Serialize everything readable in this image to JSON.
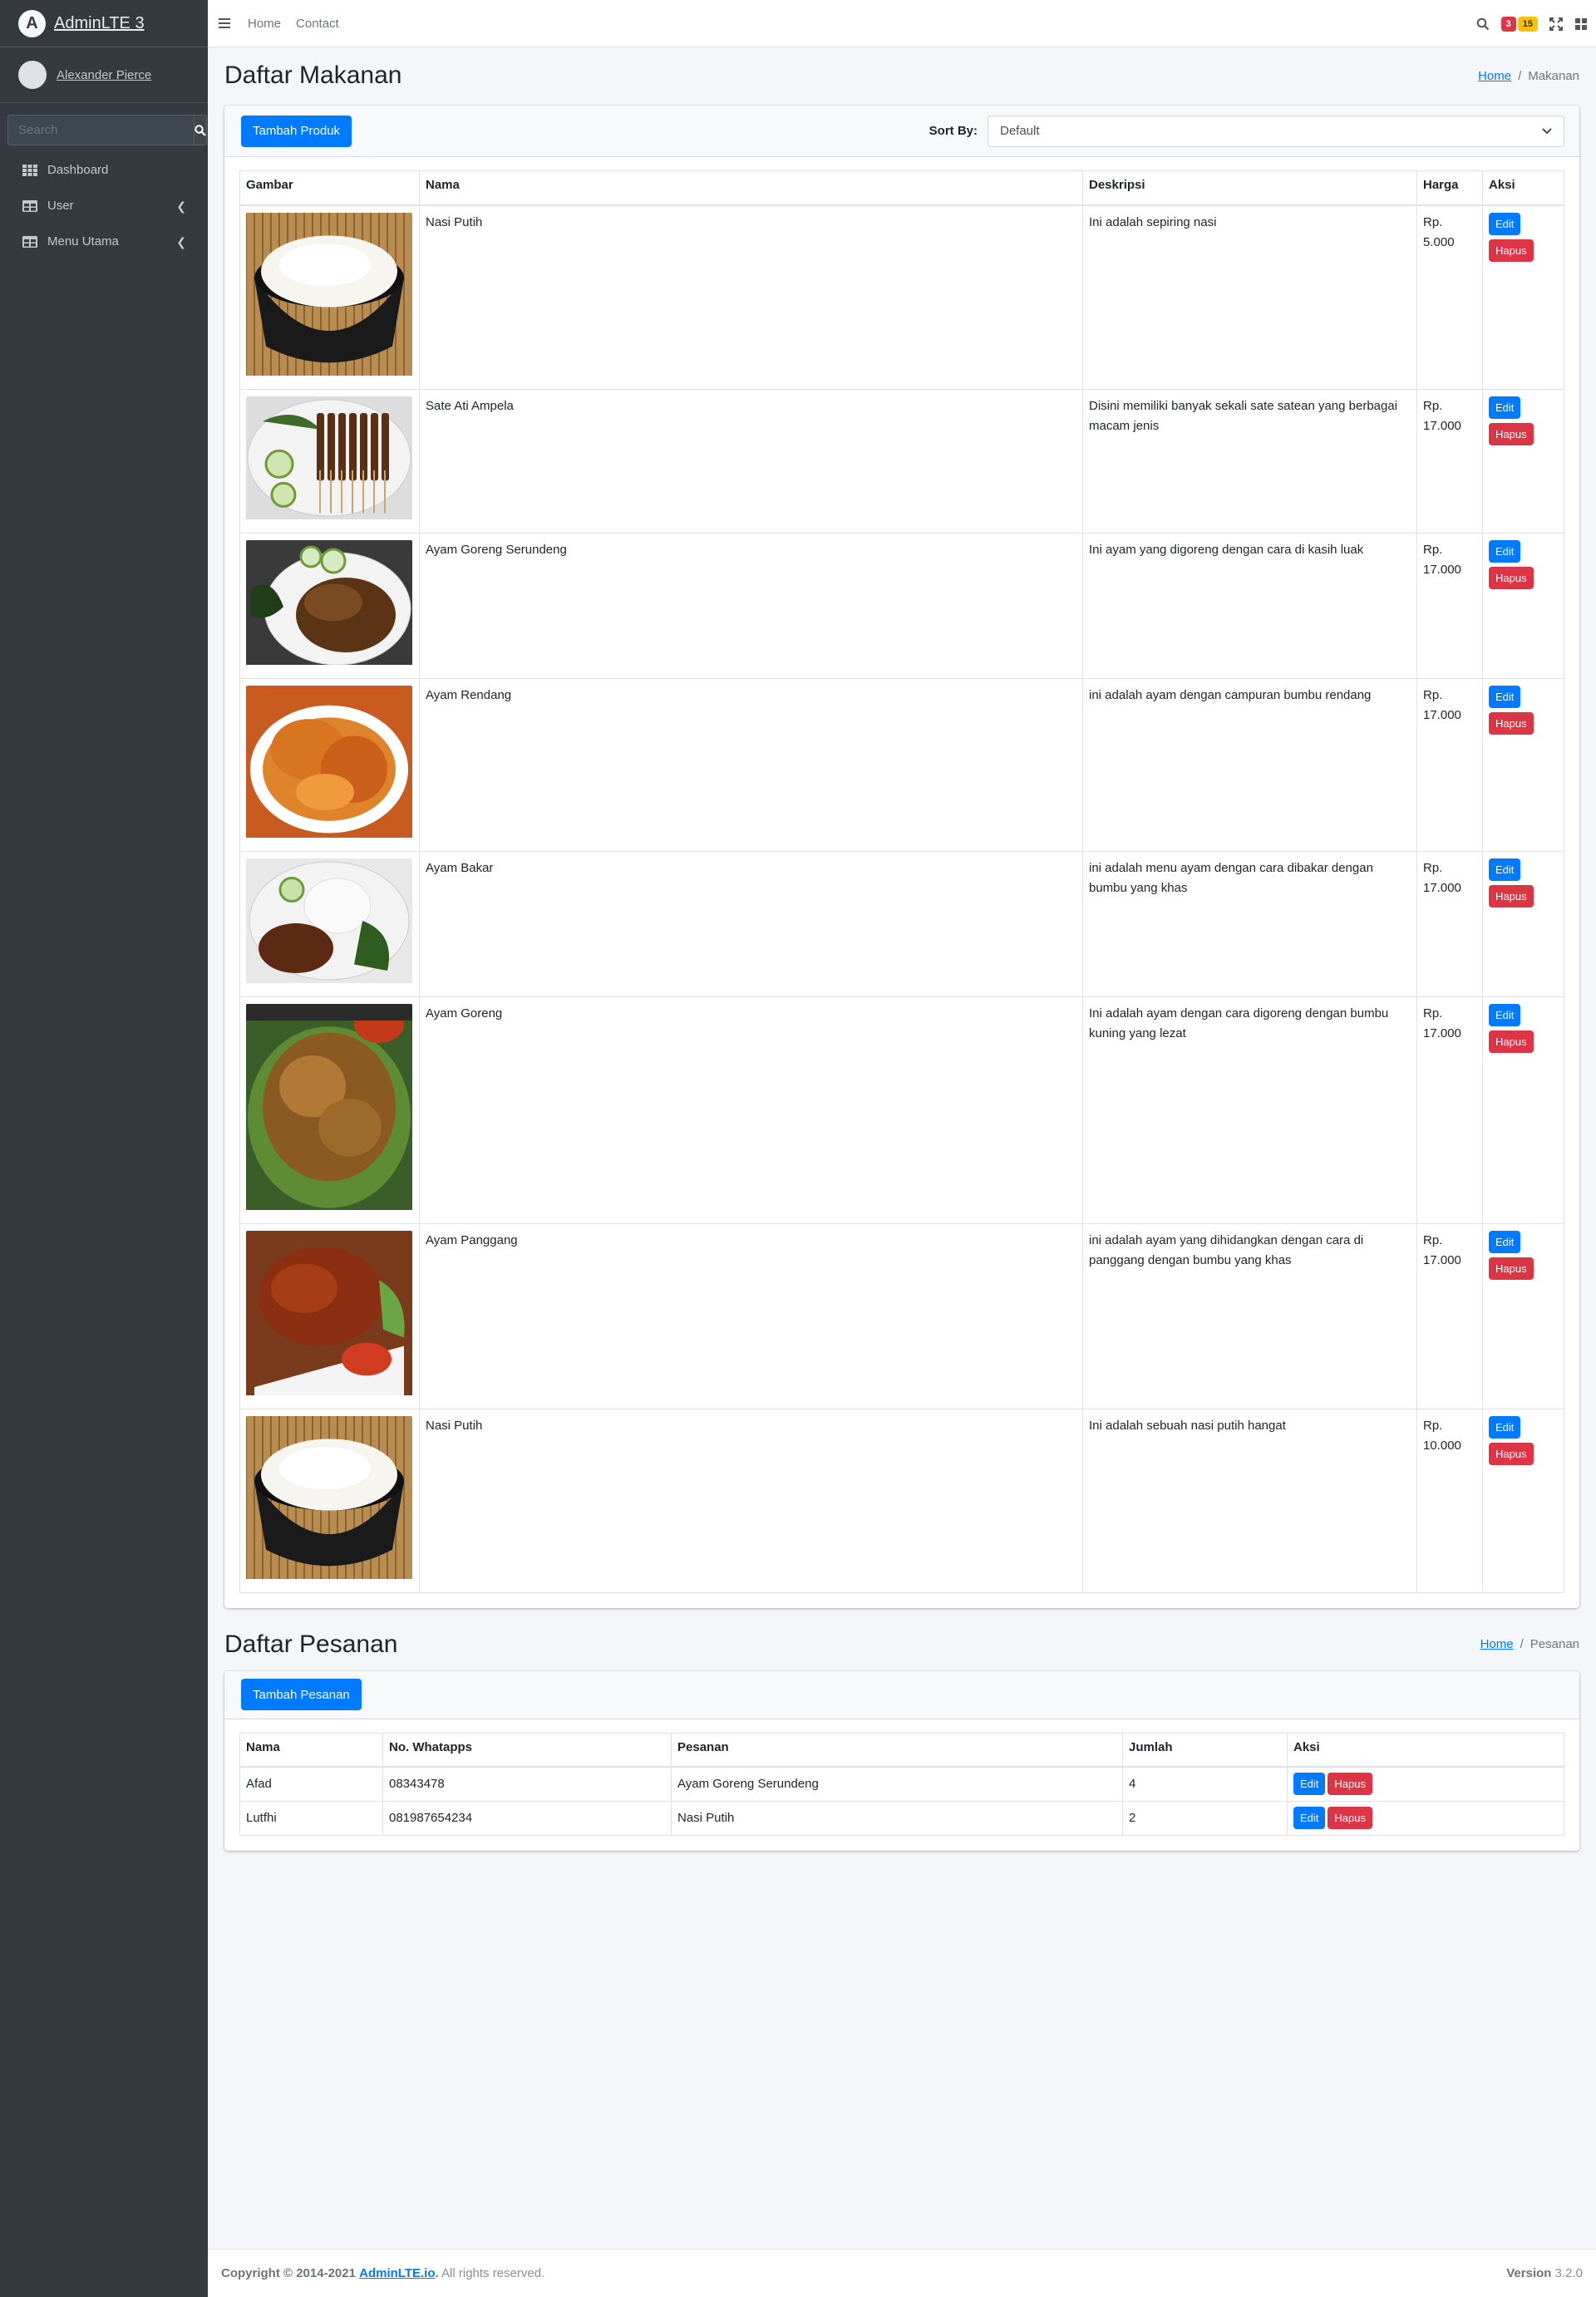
{
  "brand": {
    "name": "AdminLTE 3",
    "logo_letter": "A"
  },
  "user": {
    "name": "Alexander Pierce"
  },
  "sidebar": {
    "search_placeholder": "Search",
    "items": [
      {
        "label": "Dashboard",
        "icon": "th-icon"
      },
      {
        "label": "User",
        "icon": "table-icon"
      },
      {
        "label": "Menu Utama",
        "icon": "table-icon"
      }
    ]
  },
  "topnav": {
    "links": [
      "Home",
      "Contact"
    ],
    "messages_count": "3",
    "notifications_count": "15"
  },
  "makanan": {
    "title": "Daftar Makanan",
    "breadcrumb": {
      "home": "Home",
      "current": "Makanan"
    },
    "add_button": "Tambah Produk",
    "sort_label": "Sort By:",
    "sort_value": "Default",
    "columns": [
      "Gambar",
      "Nama",
      "Deskripsi",
      "Harga",
      "Aksi"
    ],
    "rows": [
      {
        "image": "nasi",
        "nama": "Nasi Putih",
        "deskripsi": "Ini adalah sepiring nasi",
        "harga": "Rp. 5.000"
      },
      {
        "image": "sate",
        "nama": "Sate Ati Ampela",
        "deskripsi": "Disini memiliki banyak sekali sate satean yang berbagai macam jenis",
        "harga": "Rp. 17.000"
      },
      {
        "image": "serundeng",
        "nama": "Ayam Goreng Serundeng",
        "deskripsi": "Ini ayam yang digoreng dengan cara di kasih luak",
        "harga": "Rp. 17.000"
      },
      {
        "image": "rendang",
        "nama": "Ayam Rendang",
        "deskripsi": "ini adalah ayam dengan campuran bumbu rendang",
        "harga": "Rp. 17.000"
      },
      {
        "image": "bakar",
        "nama": "Ayam Bakar",
        "deskripsi": "ini adalah menu ayam dengan cara dibakar dengan bumbu yang khas",
        "harga": "Rp. 17.000"
      },
      {
        "image": "goreng",
        "nama": "Ayam Goreng",
        "deskripsi": "Ini adalah ayam dengan cara digoreng dengan bumbu kuning yang lezat",
        "harga": "Rp. 17.000"
      },
      {
        "image": "panggang",
        "nama": "Ayam Panggang",
        "deskripsi": "ini adalah ayam yang dihidangkan dengan cara di panggang dengan bumbu yang khas",
        "harga": "Rp. 17.000"
      },
      {
        "image": "nasi",
        "nama": "Nasi Putih",
        "deskripsi": "Ini adalah sebuah nasi putih hangat",
        "harga": "Rp. 10.000"
      }
    ],
    "edit_label": "Edit",
    "delete_label": "Hapus"
  },
  "pesanan": {
    "title": "Daftar Pesanan",
    "breadcrumb": {
      "home": "Home",
      "current": "Pesanan"
    },
    "add_button": "Tambah Pesanan",
    "columns": [
      "Nama",
      "No. Whatapps",
      "Pesanan",
      "Jumlah",
      "Aksi"
    ],
    "rows": [
      {
        "nama": "Afad",
        "whatsapp": "08343478",
        "pesanan": "Ayam Goreng Serundeng",
        "jumlah": "4"
      },
      {
        "nama": "Lutfhi",
        "whatsapp": "081987654234",
        "pesanan": "Nasi Putih",
        "jumlah": "2"
      }
    ],
    "edit_label": "Edit",
    "delete_label": "Hapus"
  },
  "footer": {
    "copyright": "Copyright © 2014-2021",
    "link": "AdminLTE.io",
    "rights": "All rights reserved.",
    "version_label": "Version",
    "version": "3.2.0"
  }
}
